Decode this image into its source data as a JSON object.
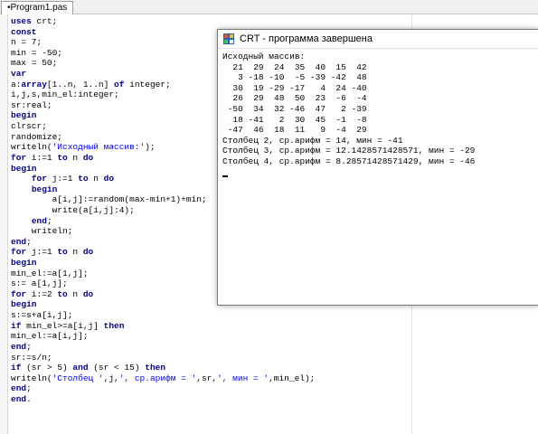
{
  "tab": {
    "label": "•Program1.pas"
  },
  "editor": {
    "lines": [
      [
        [
          "kw",
          "uses"
        ],
        [
          "t",
          " crt;"
        ]
      ],
      [
        [
          "kw",
          "const"
        ]
      ],
      [
        [
          "t",
          "n = 7;"
        ]
      ],
      [
        [
          "t",
          "min = -50;"
        ]
      ],
      [
        [
          "t",
          "max = 50;"
        ]
      ],
      [
        [
          "kw",
          "var"
        ]
      ],
      [
        [
          "t",
          "a:"
        ],
        [
          "kw",
          "array"
        ],
        [
          "t",
          "[1..n, 1..n] "
        ],
        [
          "kw",
          "of"
        ],
        [
          "t",
          " integer;"
        ]
      ],
      [
        [
          "t",
          "i,j,s,min_el:integer;"
        ]
      ],
      [
        [
          "t",
          "sr:real;"
        ]
      ],
      [
        [
          "kw",
          "begin"
        ]
      ],
      [
        [
          "t",
          "clrscr;"
        ]
      ],
      [
        [
          "t",
          "randomize;"
        ]
      ],
      [
        [
          "t",
          "writeln("
        ],
        [
          "str",
          "'Исходный массив:'"
        ],
        [
          "t",
          ");"
        ]
      ],
      [
        [
          "kw",
          "for"
        ],
        [
          "t",
          " i:=1 "
        ],
        [
          "kw",
          "to"
        ],
        [
          "t",
          " n "
        ],
        [
          "kw",
          "do"
        ]
      ],
      [
        [
          "kw",
          "begin"
        ]
      ],
      [
        [
          "t",
          "    "
        ],
        [
          "kw",
          "for"
        ],
        [
          "t",
          " j:=1 "
        ],
        [
          "kw",
          "to"
        ],
        [
          "t",
          " n "
        ],
        [
          "kw",
          "do"
        ]
      ],
      [
        [
          "t",
          "    "
        ],
        [
          "kw",
          "begin"
        ]
      ],
      [
        [
          "t",
          "        a[i,j]:=random(max-min+1)+min;"
        ]
      ],
      [
        [
          "t",
          "        write(a[i,j]:4);"
        ]
      ],
      [
        [
          "t",
          "    "
        ],
        [
          "kw",
          "end"
        ],
        [
          "t",
          ";"
        ]
      ],
      [
        [
          "t",
          "    writeln;"
        ]
      ],
      [
        [
          "kw",
          "end"
        ],
        [
          "t",
          ";"
        ]
      ],
      [
        [
          "kw",
          "for"
        ],
        [
          "t",
          " j:=1 "
        ],
        [
          "kw",
          "to"
        ],
        [
          "t",
          " n "
        ],
        [
          "kw",
          "do"
        ]
      ],
      [
        [
          "kw",
          "begin"
        ]
      ],
      [
        [
          "t",
          "min_el:=a[1,j];"
        ]
      ],
      [
        [
          "t",
          "s:= a[1,j];"
        ]
      ],
      [
        [
          "kw",
          "for"
        ],
        [
          "t",
          " i:=2 "
        ],
        [
          "kw",
          "to"
        ],
        [
          "t",
          " n "
        ],
        [
          "kw",
          "do"
        ]
      ],
      [
        [
          "kw",
          "begin"
        ]
      ],
      [
        [
          "t",
          "s:=s+a[i,j];"
        ]
      ],
      [
        [
          "kw",
          "if"
        ],
        [
          "t",
          " min_el>=a[i,j] "
        ],
        [
          "kw",
          "then"
        ]
      ],
      [
        [
          "t",
          "min_el:=a[i,j];"
        ]
      ],
      [
        [
          "kw",
          "end"
        ],
        [
          "t",
          ";"
        ]
      ],
      [
        [
          "t",
          "sr:=s/n;"
        ]
      ],
      [
        [
          "kw",
          "if"
        ],
        [
          "t",
          " (sr > 5) "
        ],
        [
          "kw",
          "and"
        ],
        [
          "t",
          " (sr < 15) "
        ],
        [
          "kw",
          "then"
        ]
      ],
      [
        [
          "t",
          "writeln("
        ],
        [
          "str",
          "'Столбец '"
        ],
        [
          "t",
          ",j,"
        ],
        [
          "str",
          "', ср.арифм = '"
        ],
        [
          "t",
          ",sr,"
        ],
        [
          "str",
          "', мин = '"
        ],
        [
          "t",
          ",min_el);"
        ]
      ],
      [
        [
          "kw",
          "end"
        ],
        [
          "t",
          ";"
        ]
      ],
      [
        [
          "kw",
          "end"
        ],
        [
          "t",
          "."
        ]
      ]
    ]
  },
  "crt": {
    "title": "CRT - программа завершена",
    "lines": [
      "Исходный массив:",
      "  21  29  24  35  40  15  42",
      "   3 -18 -10  -5 -39 -42  48",
      "  30  19 -29 -17   4  24 -40",
      "  26  29  48  50  23  -6  -4",
      " -50  34  32 -46  47   2 -39",
      "  18 -41   2  30  45  -1  -8",
      " -47  46  18  11   9  -4  29",
      "Столбец 2, ср.арифм = 14, мин = -41",
      "Столбец 3, ср.арифм = 12.1428571428571, мин = -29",
      "Столбец 4, ср.арифм = 8.28571428571429, мин = -46"
    ]
  },
  "colors": {
    "keyword": "#00008b",
    "string": "#0000ff"
  },
  "icons": {
    "crt_icon": "crt-window-icon"
  }
}
